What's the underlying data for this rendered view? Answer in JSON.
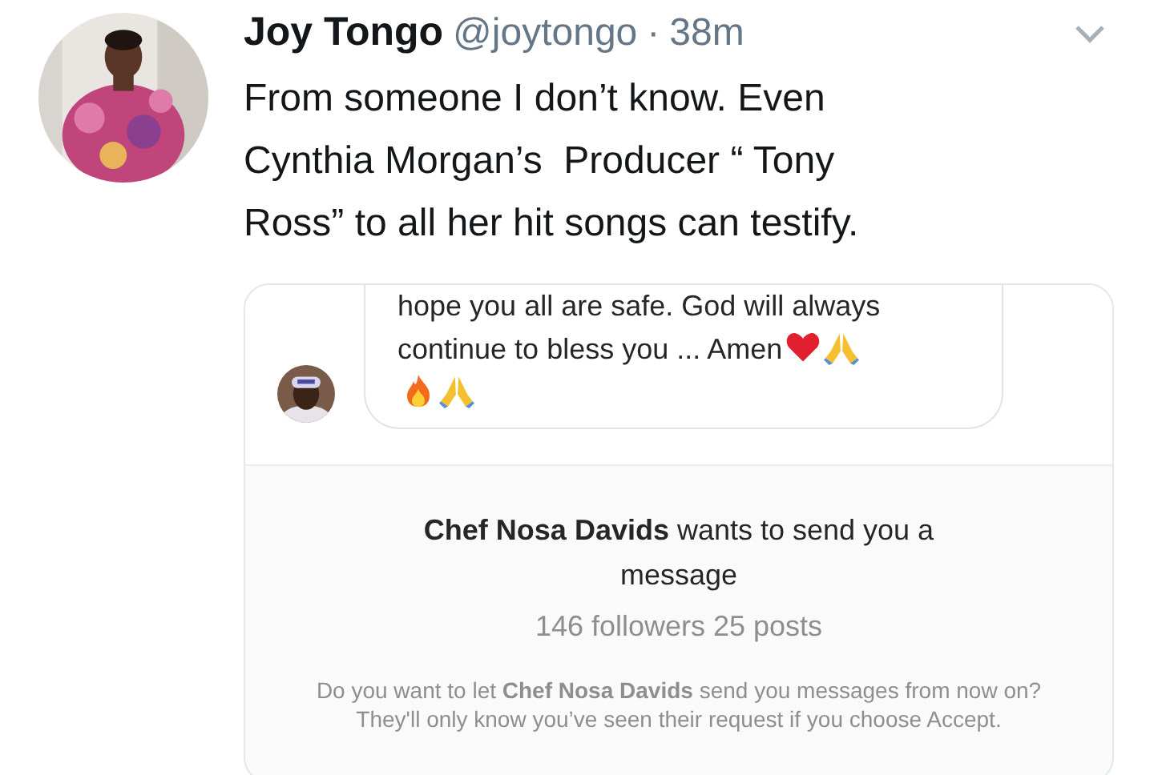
{
  "tweet": {
    "name": "Joy Tongo",
    "handle": "@joytongo",
    "separator": "·",
    "time": "38m",
    "text": "From someone I don’t know. Even Cynthia Morgan’s  Producer “ Tony Ross” to all her hit songs can testify."
  },
  "embedded": {
    "message_lines": [
      "hope you all are safe. God will always",
      "continue to bless you ... Amen"
    ],
    "request": "**Chef Nosa Davids** wants to send you a message",
    "stats": "146 followers 25 posts",
    "notice": "Do you want to let **Chef Nosa Davids** send you messages from now on? They'll only know you’ve seen their request if you choose Accept."
  }
}
